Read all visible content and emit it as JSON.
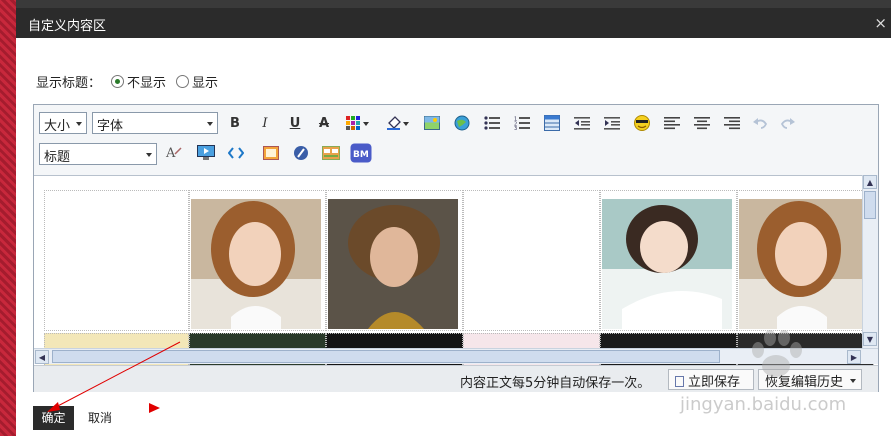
{
  "dialog": {
    "title": "自定义内容区",
    "close": "×"
  },
  "show_title": {
    "label": "显示标题：",
    "options": [
      {
        "label": "不显示",
        "checked": true
      },
      {
        "label": "显示",
        "checked": false
      }
    ]
  },
  "toolbar": {
    "size_select": "大小",
    "font_select": "字体",
    "heading_select": "标题",
    "bold": "B",
    "italic": "I",
    "underline": "U",
    "strike": "A",
    "bm_icon": "BM"
  },
  "status": {
    "autosave_msg": "内容正文每5分钟自动保存一次。",
    "save_now": "立即保存",
    "restore": "恢复编辑历史"
  },
  "actions": {
    "ok": "确定",
    "cancel": "取消"
  },
  "watermark": "jingyan.baidu.com",
  "colors": {
    "titlebar": "#2b2b2b",
    "ok_button": "#2b2b2b",
    "annotation": "#e00000"
  }
}
